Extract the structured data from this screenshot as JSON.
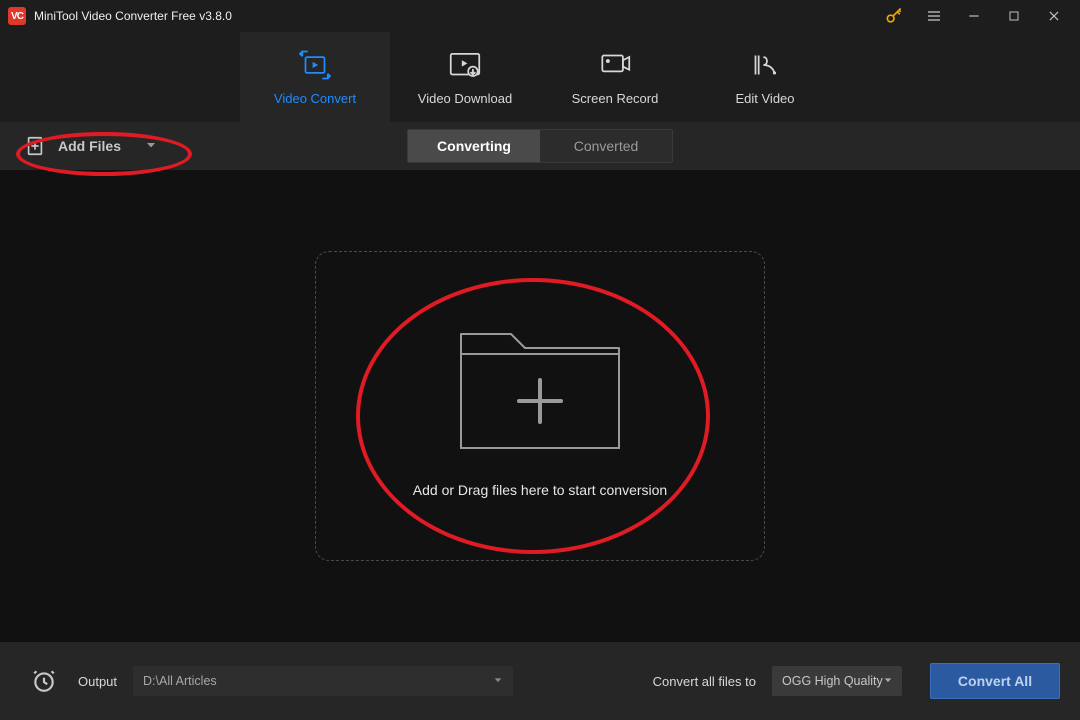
{
  "titlebar": {
    "logo_text": "VC",
    "title": "MiniTool Video Converter Free v3.8.0"
  },
  "nav": {
    "items": [
      {
        "label": "Video Convert"
      },
      {
        "label": "Video Download"
      },
      {
        "label": "Screen Record"
      },
      {
        "label": "Edit Video"
      }
    ],
    "active_index": 0
  },
  "toolbar": {
    "add_files_label": "Add Files",
    "segment": {
      "converting": "Converting",
      "converted": "Converted",
      "active": "converting"
    }
  },
  "dropzone": {
    "text": "Add or Drag files here to start conversion"
  },
  "bottombar": {
    "output_label": "Output",
    "output_path": "D:\\All Articles",
    "convert_all_files_to_label": "Convert all files to",
    "format_selected": "OGG High Quality",
    "convert_all_button": "Convert All"
  }
}
